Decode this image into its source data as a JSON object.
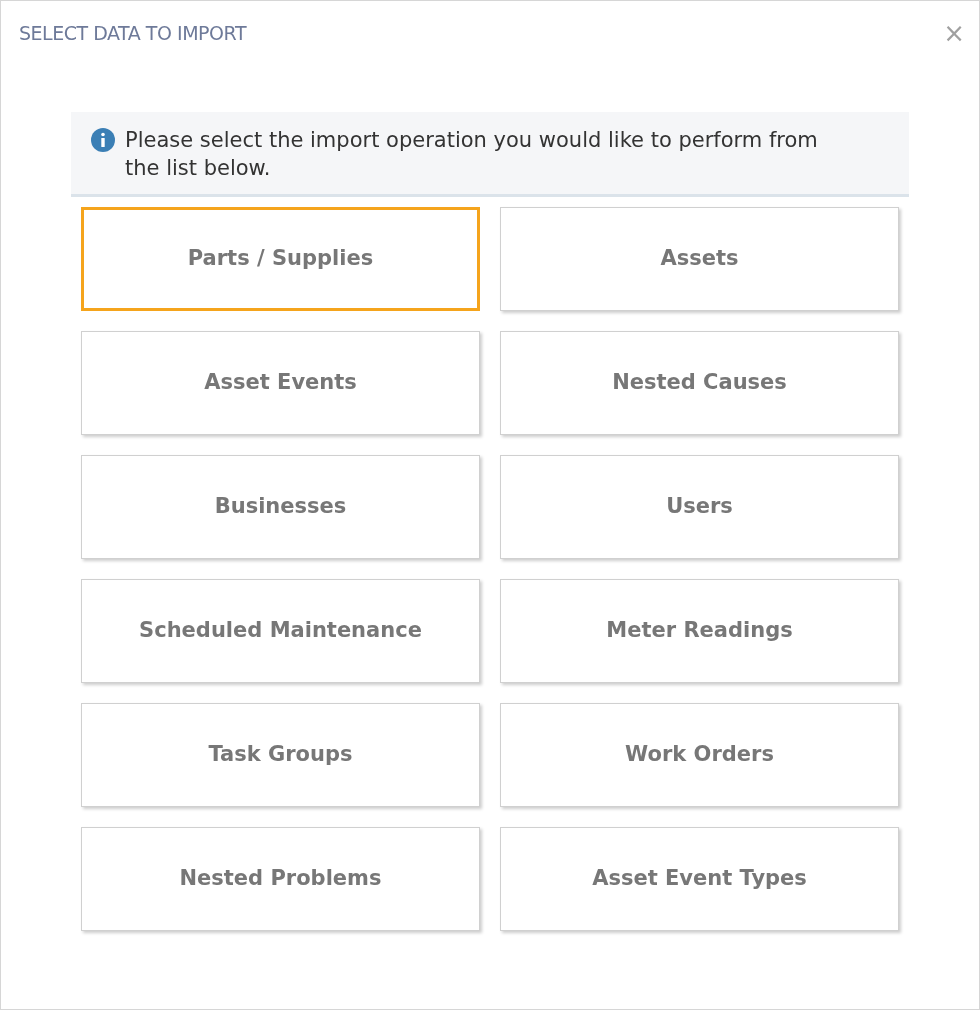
{
  "dialog": {
    "title": "SELECT DATA TO IMPORT",
    "close": "×"
  },
  "info": {
    "text": "Please select the import operation you would like to perform from the list below."
  },
  "options": [
    {
      "label": "Parts / Supplies",
      "selected": true
    },
    {
      "label": "Assets",
      "selected": false
    },
    {
      "label": "Asset Events",
      "selected": false
    },
    {
      "label": "Nested Causes",
      "selected": false
    },
    {
      "label": "Businesses",
      "selected": false
    },
    {
      "label": "Users",
      "selected": false
    },
    {
      "label": "Scheduled Maintenance",
      "selected": false
    },
    {
      "label": "Meter Readings",
      "selected": false
    },
    {
      "label": "Task Groups",
      "selected": false
    },
    {
      "label": "Work Orders",
      "selected": false
    },
    {
      "label": "Nested Problems",
      "selected": false
    },
    {
      "label": "Asset Event Types",
      "selected": false
    }
  ]
}
